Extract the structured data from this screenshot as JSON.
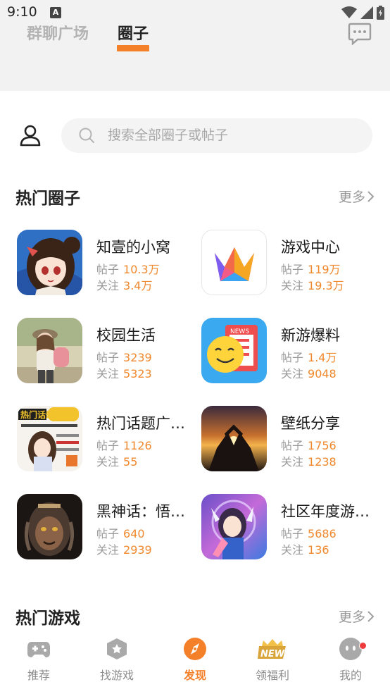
{
  "status": {
    "time": "9:10",
    "badge": "A"
  },
  "header": {
    "tabs": [
      {
        "label": "群聊广场",
        "active": false
      },
      {
        "label": "圈子",
        "active": true
      }
    ],
    "accent_color": "#f5802a"
  },
  "search": {
    "placeholder": "搜索全部圈子或帖子"
  },
  "hot_circles": {
    "title": "热门圈子",
    "more_label": "更多",
    "posts_label": "帖子",
    "follow_label": "关注",
    "items": [
      {
        "name": "知壹的小窝",
        "posts": "10.3万",
        "followers": "3.4万"
      },
      {
        "name": "游戏中心",
        "posts": "119万",
        "followers": "19.3万"
      },
      {
        "name": "校园生活",
        "posts": "3239",
        "followers": "5323"
      },
      {
        "name": "新游爆料",
        "posts": "1.4万",
        "followers": "9048",
        "thumb_text": "NEWS"
      },
      {
        "name": "热门话题广…",
        "posts": "1126",
        "followers": "55",
        "thumb_text": "热门话题"
      },
      {
        "name": "壁纸分享",
        "posts": "1756",
        "followers": "1238"
      },
      {
        "name": "黑神话：悟…",
        "posts": "640",
        "followers": "2939"
      },
      {
        "name": "社区年度游…",
        "posts": "5686",
        "followers": "136"
      }
    ]
  },
  "hot_games": {
    "title": "热门游戏",
    "more_label": "更多"
  },
  "bottom_nav": {
    "items": [
      {
        "label": "推荐",
        "icon": "gamepad-icon"
      },
      {
        "label": "找游戏",
        "icon": "hexagon-star-icon"
      },
      {
        "label": "发现",
        "icon": "compass-icon",
        "active": true
      },
      {
        "label": "领福利",
        "icon": "new-badge-icon",
        "badge_text": "NEW"
      },
      {
        "label": "我的",
        "icon": "face-icon",
        "has_dot": true
      }
    ]
  }
}
